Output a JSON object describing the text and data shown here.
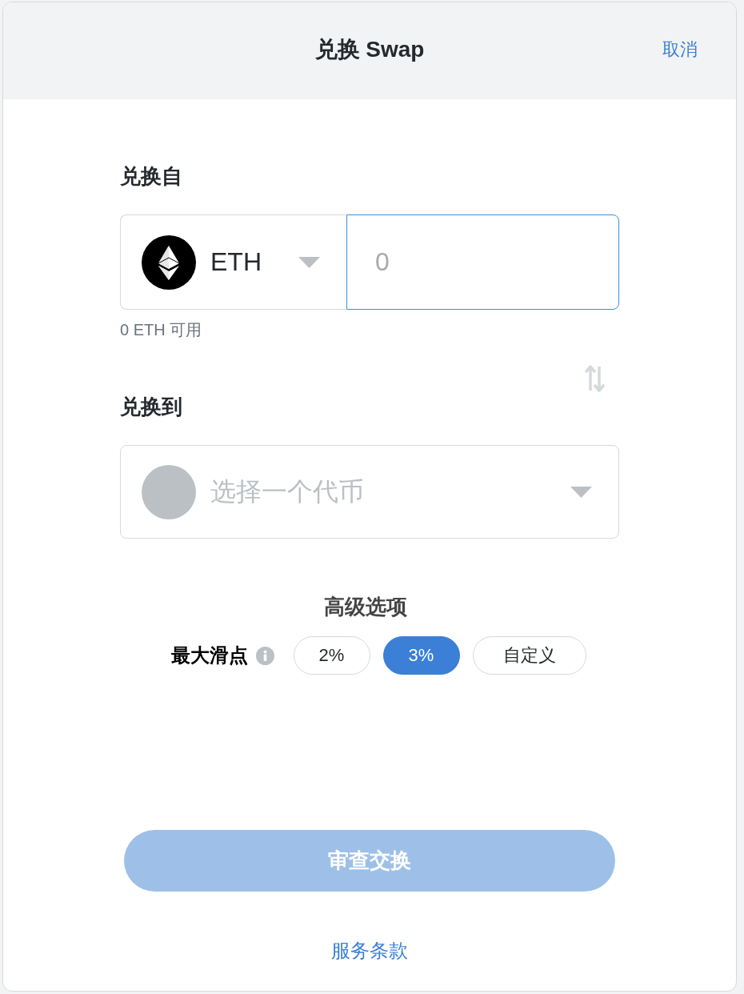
{
  "header": {
    "title": "兑换 Swap",
    "cancel": "取消"
  },
  "from": {
    "label": "兑换自",
    "token": {
      "symbol": "ETH"
    },
    "amount": {
      "placeholder": "0",
      "focused": true
    },
    "balance": "0 ETH 可用"
  },
  "to": {
    "label": "兑换到",
    "token": {
      "placeholder": "选择一个代币"
    }
  },
  "advanced": {
    "title": "高级选项",
    "slippage": {
      "label": "最大滑点",
      "options": [
        {
          "label": "2%",
          "selected": false
        },
        {
          "label": "3%",
          "selected": true
        },
        {
          "label": "自定义",
          "selected": false
        }
      ]
    }
  },
  "review_button": {
    "label": "审查交换",
    "disabled": true
  },
  "terms_link": "服务条款"
}
